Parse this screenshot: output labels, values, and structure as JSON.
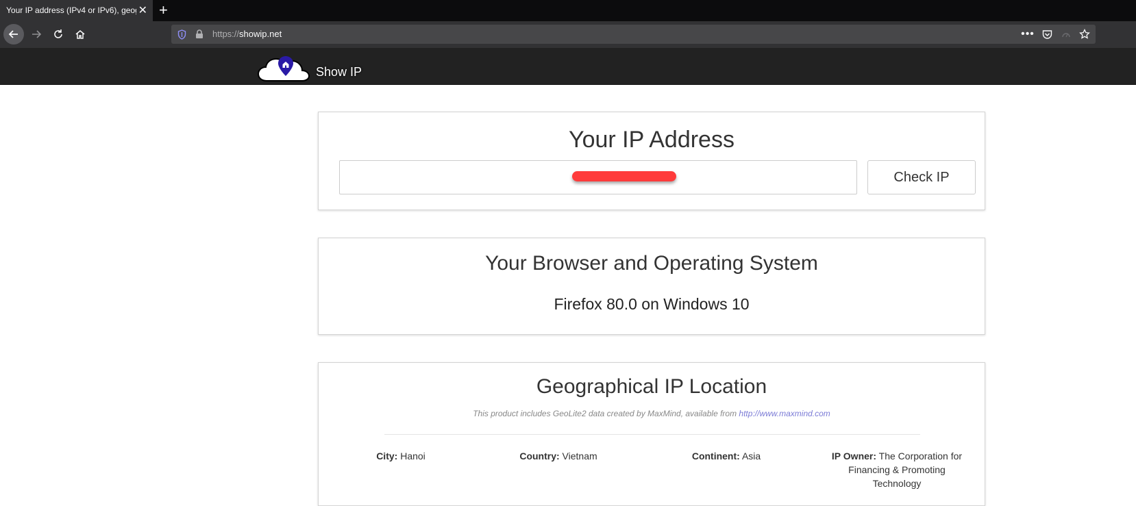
{
  "browser": {
    "tab_title": "Your IP address (IPv4 or IPv6), geog",
    "url_protocol": "https://",
    "url_host": "showip.net",
    "icons": [
      "back-icon",
      "forward-icon",
      "reload-icon",
      "home-icon",
      "shield-icon",
      "lock-icon",
      "more-icon",
      "pocket-icon",
      "reader-icon",
      "star-icon",
      "close-icon",
      "plus-icon"
    ]
  },
  "site": {
    "brand": "Show IP"
  },
  "ip_panel": {
    "title": "Your IP Address",
    "ip_value": "",
    "check_button": "Check IP"
  },
  "browser_panel": {
    "title": "Your Browser and Operating System",
    "value": "Firefox 80.0 on Windows 10"
  },
  "geo_panel": {
    "title": "Geographical IP Location",
    "credit_text": "This product includes GeoLite2 data created by MaxMind, available from",
    "credit_link": "http://www.maxmind.com",
    "city_label": "City:",
    "city": "Hanoi",
    "country_label": "Country:",
    "country": "Vietnam",
    "continent_label": "Continent:",
    "continent": "Asia",
    "owner_label": "IP Owner:",
    "owner": "The Corporation for Financing & Promoting Technology"
  },
  "colors": {
    "chrome_dark": "#0c0c0d",
    "chrome_toolbar": "#323234",
    "site_header": "#222222",
    "redaction": "#ff3b3b",
    "link": "#7b7bd6"
  }
}
